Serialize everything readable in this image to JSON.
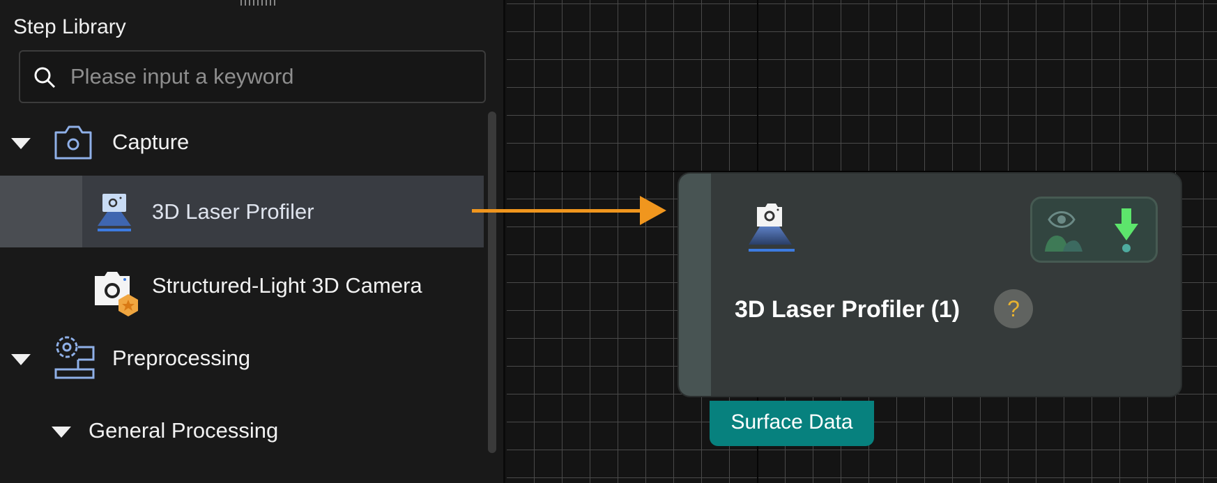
{
  "panel": {
    "title": "Step Library",
    "search_placeholder": "Please input a keyword",
    "tree": [
      {
        "label": "Capture",
        "icon": "camera-outline-icon",
        "expanded": true
      },
      {
        "label": "3D Laser Profiler",
        "icon": "laser-profiler-icon",
        "selected": true
      },
      {
        "label": "Structured-Light 3D Camera",
        "icon": "structured-light-camera-icon"
      },
      {
        "label": "Preprocessing",
        "icon": "preprocessing-gear-icon",
        "expanded": true
      },
      {
        "label": "General Processing",
        "expanded": true
      }
    ]
  },
  "node": {
    "title": "3D Laser Profiler (1)",
    "help": "?",
    "output_port": "Surface Data"
  },
  "colors": {
    "accent_arrow": "#f0961e",
    "port": "#07817e",
    "selected_row": "#393c42"
  }
}
